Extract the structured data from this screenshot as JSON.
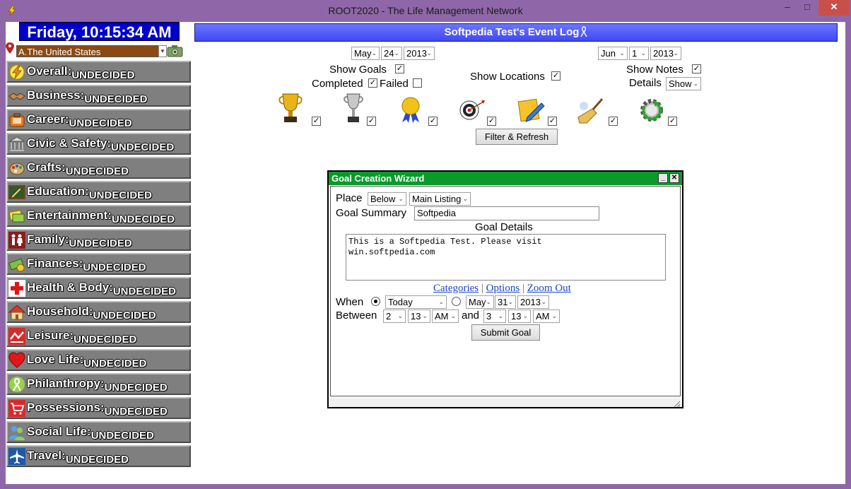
{
  "window": {
    "title": "ROOT2020 - The Life Management Network",
    "minimize": "–",
    "maximize": "□",
    "close": "✕"
  },
  "clock": "Friday, 10:15:34 AM",
  "country": "A.The United States",
  "categories": [
    {
      "name": "Overall:",
      "status": "UNDECIDED",
      "icon": "lightning-icon"
    },
    {
      "name": "Business:",
      "status": "UNDECIDED",
      "icon": "handshake-icon"
    },
    {
      "name": "Career:",
      "status": "UNDECIDED",
      "icon": "briefcase-icon"
    },
    {
      "name": "Civic & Safety:",
      "status": "UNDECIDED",
      "icon": "building-icon"
    },
    {
      "name": "Crafts:",
      "status": "UNDECIDED",
      "icon": "palette-icon"
    },
    {
      "name": "Education:",
      "status": "UNDECIDED",
      "icon": "pencil-icon"
    },
    {
      "name": "Entertainment:",
      "status": "UNDECIDED",
      "icon": "tickets-icon"
    },
    {
      "name": "Family:",
      "status": "UNDECIDED",
      "icon": "family-icon"
    },
    {
      "name": "Finances:",
      "status": "UNDECIDED",
      "icon": "money-icon"
    },
    {
      "name": "Health & Body:",
      "status": "UNDECIDED",
      "icon": "red-cross-icon"
    },
    {
      "name": "Household:",
      "status": "UNDECIDED",
      "icon": "house-icon"
    },
    {
      "name": "Leisure:",
      "status": "UNDECIDED",
      "icon": "leisure-icon"
    },
    {
      "name": "Love Life:",
      "status": "UNDECIDED",
      "icon": "heart-icon"
    },
    {
      "name": "Philanthropy:",
      "status": "UNDECIDED",
      "icon": "ribbon-icon"
    },
    {
      "name": "Possessions:",
      "status": "UNDECIDED",
      "icon": "cart-icon"
    },
    {
      "name": "Social Life:",
      "status": "UNDECIDED",
      "icon": "people-icon"
    },
    {
      "name": "Travel:",
      "status": "UNDECIDED",
      "icon": "airplane-icon"
    }
  ],
  "log": {
    "title": "Softpedia Test's Event Log",
    "from": {
      "month": "May",
      "day": "24",
      "year": "2013"
    },
    "to": {
      "month": "Jun",
      "day": "1",
      "year": "2013"
    },
    "show_goals_label": "Show Goals",
    "completed_label": "Completed",
    "failed_label": "Failed",
    "show_locations_label": "Show Locations",
    "show_notes_label": "Show Notes",
    "details_label": "Details",
    "details_value": "Show",
    "filter_button": "Filter & Refresh",
    "filters": [
      {
        "icon": "gold-trophy-icon",
        "checked": true
      },
      {
        "icon": "silver-trophy-icon",
        "checked": true
      },
      {
        "icon": "ribbon-medal-icon",
        "checked": true
      },
      {
        "icon": "target-icon",
        "checked": true
      },
      {
        "icon": "note-pencil-icon",
        "checked": true
      },
      {
        "icon": "broom-icon",
        "checked": true
      },
      {
        "icon": "refresh-gear-icon",
        "checked": true
      }
    ]
  },
  "wizard": {
    "title": "Goal Creation Wizard",
    "place_label": "Place",
    "place_position": "Below",
    "place_target": "Main Listing",
    "summary_label": "Goal Summary",
    "summary_value": "Softpedia",
    "details_label": "Goal Details",
    "details_value": "This is a Softpedia Test. Please visit\nwin.softpedia.com",
    "links": {
      "categories": "Categories",
      "options": "Options",
      "zoom_out": "Zoom Out"
    },
    "when_label": "When",
    "when_value": "Today",
    "when_month": "May",
    "when_day": "31",
    "when_year": "2013",
    "between_label": "Between",
    "start_hour": "2",
    "start_min": "13",
    "start_ampm": "AM",
    "and_label": "and",
    "end_hour": "3",
    "end_min": "13",
    "end_ampm": "AM",
    "submit_button": "Submit Goal"
  },
  "colors": {
    "frame": "#8f67a8",
    "clock_bg": "#0000cc",
    "header_bg": "#4a52f7",
    "wizard_title_bg": "#0a9a2a",
    "category_bg": "#7f7f7f"
  }
}
